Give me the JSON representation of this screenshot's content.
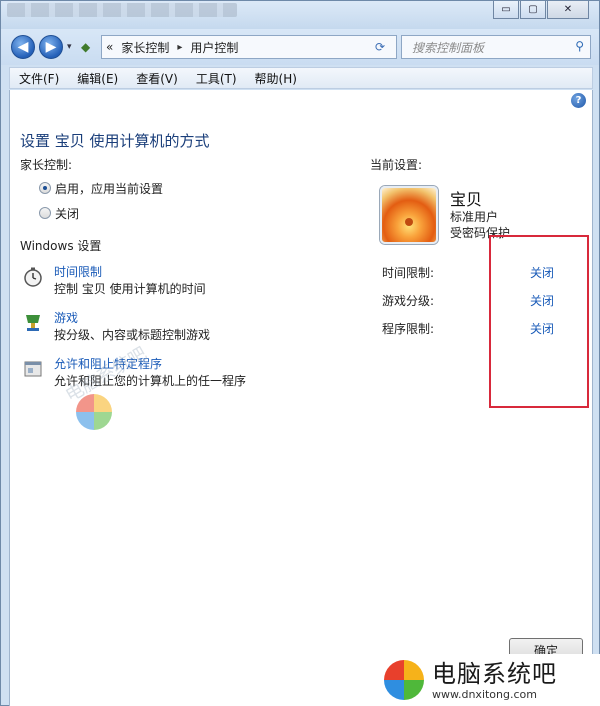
{
  "window": {
    "controls": {
      "minimize": "▭",
      "maximize": "▢",
      "close": "✕"
    }
  },
  "address": {
    "back_glyph": "◀",
    "forward_glyph": "▶",
    "dropdown_glyph": "▾",
    "prefix": "«",
    "crumb1": "家长控制",
    "separator": "▸",
    "crumb2": "用户控制",
    "search_placeholder": "搜索控制面板"
  },
  "menu": [
    "文件(F)",
    "编辑(E)",
    "查看(V)",
    "工具(T)",
    "帮助(H)"
  ],
  "content": {
    "help_glyph": "?",
    "title": "设置 宝贝 使用计算机的方式",
    "parental_label": "家长控制:",
    "radio_on": "启用，应用当前设置",
    "radio_off": "关闭",
    "windows_label": "Windows 设置",
    "tasks": [
      {
        "icon": "stopwatch-icon",
        "link": "时间限制",
        "desc": "控制 宝贝 使用计算机的时间"
      },
      {
        "icon": "games-icon",
        "link": "游戏",
        "desc": "按分级、内容或标题控制游戏"
      },
      {
        "icon": "program-icon",
        "link": "允许和阻止特定程序",
        "desc": "允许和阻止您的计算机上的任一程序"
      }
    ],
    "current_label": "当前设置:",
    "user": {
      "name": "宝贝",
      "type": "标准用户",
      "protection": "受密码保护"
    },
    "settings": [
      {
        "label": "时间限制:",
        "value": "关闭"
      },
      {
        "label": "游戏分级:",
        "value": "关闭"
      },
      {
        "label": "程序限制:",
        "value": "关闭"
      }
    ],
    "ok_button": "确定"
  },
  "watermark": {
    "mid_text": "电脑系统吧",
    "brand_name": "电脑系统吧",
    "brand_url": "www.dnxitong.com"
  },
  "colors": {
    "link": "#1a5bb8",
    "title": "#1a3e7a",
    "highlight": "#d8293b"
  }
}
